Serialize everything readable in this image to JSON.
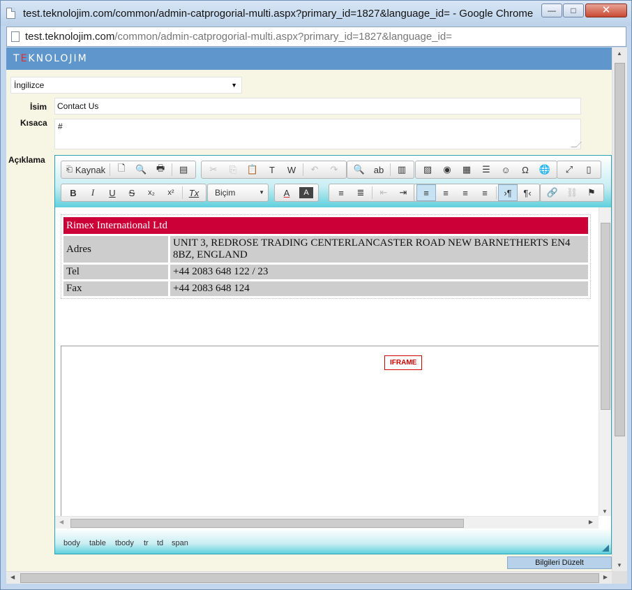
{
  "window": {
    "title": "test.teknolojim.com/common/admin-catprogorial-multi.aspx?primary_id=1827&language_id= - Google Chrome",
    "url_host": "test.teknolojim.com",
    "url_path": "/common/admin-catprogorial-multi.aspx?primary_id=1827&language_id=",
    "min_glyph": "—",
    "max_glyph": "□",
    "close_glyph": "✕"
  },
  "app": {
    "logo_pre": "T",
    "logo_e": "E",
    "logo_post": "KNOLOJIM",
    "accent_color": "#5f97cc"
  },
  "form": {
    "language": "İngilizce",
    "isim_label": "İsim",
    "isim_value": "Contact Us",
    "kisaca_label": "Kısaca",
    "kisaca_value": "#",
    "aciklama_label": "Açıklama",
    "submit_label": "Bilgileri Düzelt"
  },
  "editor": {
    "source_label": "Kaynak",
    "format_label": "Biçim",
    "toolbar_icons": {
      "new_page": "🗋",
      "preview": "🔍",
      "print": "🖶",
      "templates": "▤",
      "cut": "✂",
      "copy": "⎘",
      "paste": "📋",
      "paste_text": "T",
      "paste_word": "W",
      "undo": "↶",
      "redo": "↷",
      "find": "🔍",
      "replace": "ab",
      "select_all": "▥",
      "image": "▨",
      "flash": "◉",
      "table": "▦",
      "hline": "☰",
      "smiley": "☺",
      "special_char": "Ω",
      "iframe": "🌐",
      "maximize": "⤢",
      "show_blocks": "▯",
      "bold": "B",
      "italic": "I",
      "underline": "U",
      "strike": "S",
      "subscript": "x₂",
      "superscript": "x²",
      "remove_format": "Tx",
      "text_color": "A",
      "bg_color": "A",
      "ordered_list": "≡",
      "bullet_list": "≣",
      "outdent": "⇤",
      "indent": "⇥",
      "align_left": "≡",
      "align_center": "≡",
      "align_right": "≡",
      "justify": "≡",
      "ltr": "›¶",
      "rtl": "¶‹",
      "link": "🔗",
      "unlink": "⛓",
      "anchor": "⚑"
    },
    "table": {
      "header": "Rimex International Ltd",
      "header_color": "#cc0036",
      "rows": [
        {
          "key": "Adres",
          "value": "UNIT 3, REDROSE TRADING CENTERLANCASTER ROAD NEW BARNETHERTS EN4 8BZ, ENGLAND"
        },
        {
          "key": "Tel",
          "value": "+44 2083 648 122 / 23"
        },
        {
          "key": "Fax",
          "value": "+44 2083 648 124"
        }
      ]
    },
    "iframe_badge": "IFRAME",
    "path": [
      "body",
      "table",
      "tbody",
      "tr",
      "td",
      "span"
    ]
  },
  "scroll": {
    "up_glyph": "▲",
    "down_glyph": "▼",
    "left_glyph": "◀",
    "right_glyph": "▶"
  }
}
